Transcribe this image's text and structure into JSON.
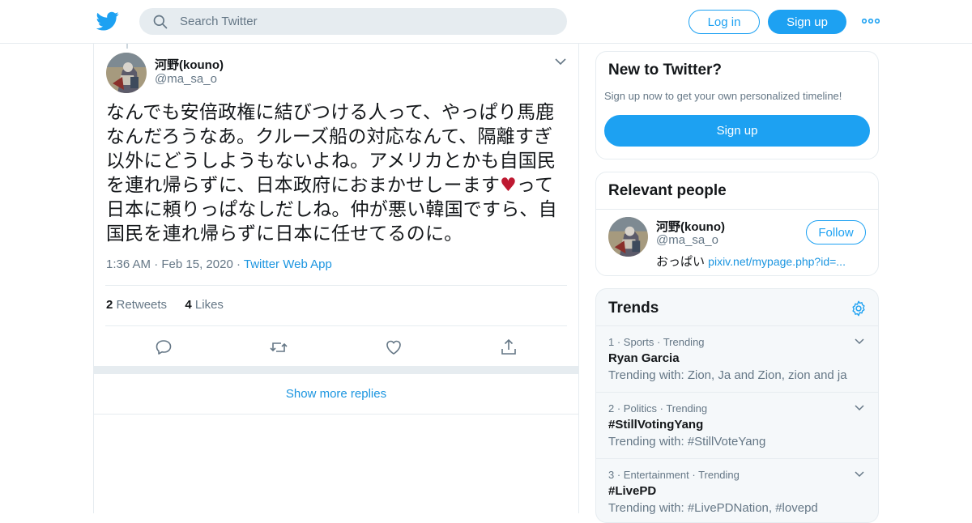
{
  "header": {
    "search_placeholder": "Search Twitter",
    "login_label": "Log in",
    "signup_label": "Sign up",
    "brand_color": "#1da1f2",
    "logo_icon": "twitter-bird-icon",
    "more_icon": "more-dots-icon"
  },
  "tweet": {
    "author_name": "河野(kouno)",
    "author_handle": "@ma_sa_o",
    "text_before_emoji": "なんでも安倍政権に結びつける人って、やっぱり馬鹿なんだろうなあ。クルーズ船の対応なんて、隔離すぎ以外にどうしようもないよね。アメリカとかも自国民を連れ帰らずに、日本政府におまかせしーます",
    "emoji": "♥",
    "text_after_emoji": "って日本に頼りっぱなしだしね。仲が悪い韓国ですら、自国民を連れ帰らずに日本に任せてるのに。",
    "time": "1:36 AM",
    "date": "Feb 15, 2020",
    "source_app": "Twitter Web App",
    "retweets_count": "2",
    "retweets_label": "Retweets",
    "likes_count": "4",
    "likes_label": "Likes",
    "actions": [
      "reply-icon",
      "retweet-icon",
      "like-icon",
      "share-icon"
    ]
  },
  "show_more_replies": "Show more replies",
  "sidebar": {
    "new_to_twitter": {
      "title": "New to Twitter?",
      "subtitle": "Sign up now to get your own personalized timeline!",
      "signup_label": "Sign up"
    },
    "relevant_people": {
      "title": "Relevant people",
      "name": "河野(kouno)",
      "handle": "@ma_sa_o",
      "follow_label": "Follow",
      "bio_text": "おっぱい ",
      "bio_link": "pixiv.net/mypage.php?id=..."
    },
    "trends": {
      "title": "Trends",
      "items": [
        {
          "rank": "1",
          "category": "Sports",
          "status": "Trending",
          "name": "Ryan Garcia",
          "with": "Trending with: Zion, Ja and Zion, zion and ja"
        },
        {
          "rank": "2",
          "category": "Politics",
          "status": "Trending",
          "name": "#StillVotingYang",
          "with": "Trending with: #StillVoteYang"
        },
        {
          "rank": "3",
          "category": "Entertainment",
          "status": "Trending",
          "name": "#LivePD",
          "with": "Trending with: #LivePDNation, #lovepd"
        }
      ]
    }
  }
}
